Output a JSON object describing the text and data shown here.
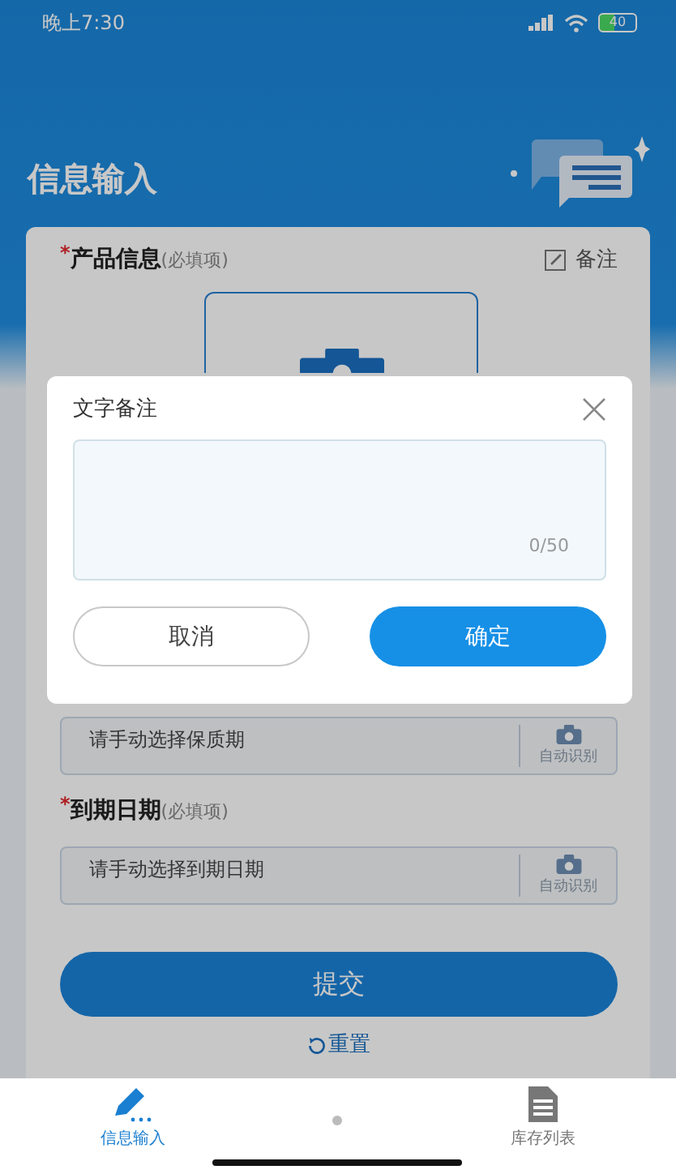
{
  "status_bar": {
    "time": "晚上7:30",
    "battery": "40"
  },
  "header": {
    "title": "信息输入"
  },
  "form": {
    "product": {
      "label": "产品信息",
      "hint": "(必填项)",
      "mark": "*",
      "note_button": "备注"
    },
    "fields": [
      {
        "placeholder": "请手动选择保质期",
        "scan_label": "自动识别"
      },
      {
        "label": "到期日期",
        "hint": "(必填项)",
        "mark": "*",
        "placeholder": "请手动选择到期日期",
        "scan_label": "自动识别"
      }
    ],
    "submit": "提交",
    "reset": "重置"
  },
  "dialog": {
    "title": "文字备注",
    "counter": "0/50",
    "cancel": "取消",
    "confirm": "确定"
  },
  "tab_bar": [
    {
      "label": "信息输入",
      "selected": true
    },
    {
      "label": "库存列表",
      "selected": false
    }
  ]
}
